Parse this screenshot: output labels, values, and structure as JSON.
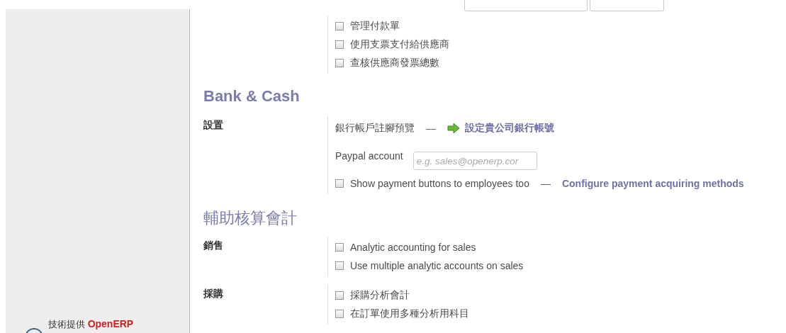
{
  "sidebar": {
    "footer": {
      "prefix": "技術提供",
      "brand": "OpenERP"
    }
  },
  "top_group": {
    "options": [
      {
        "label": "管理付款單",
        "checked": false
      },
      {
        "label": "使用支票支付給供應商",
        "checked": false
      },
      {
        "label": "查核供應商發票總數",
        "checked": false
      }
    ]
  },
  "sections": [
    {
      "title": "Bank & Cash",
      "rows": [
        {
          "label": "設置",
          "items": [
            {
              "kind": "link",
              "text": "銀行帳戶註腳預覽",
              "separator": "—",
              "link": "設定貴公司銀行帳號"
            },
            {
              "kind": "field",
              "label": "Paypal account",
              "placeholder": "e.g. sales@openerp.cor"
            },
            {
              "kind": "checkbox",
              "label": "Show payment buttons to employees too",
              "checked": false,
              "separator": "—",
              "link": "Configure payment acquiring methods"
            }
          ]
        }
      ]
    },
    {
      "title": "輔助核算會計",
      "rows": [
        {
          "label": "銷售",
          "items": [
            {
              "kind": "checkbox",
              "label": "Analytic accounting for sales",
              "checked": false
            },
            {
              "kind": "checkbox",
              "label": "Use multiple analytic accounts on sales",
              "checked": false
            }
          ]
        },
        {
          "label": "採購",
          "items": [
            {
              "kind": "checkbox",
              "label": "採購分析會計",
              "checked": false
            },
            {
              "kind": "checkbox",
              "label": "在訂單使用多種分析用科目",
              "checked": false
            }
          ]
        }
      ]
    }
  ]
}
